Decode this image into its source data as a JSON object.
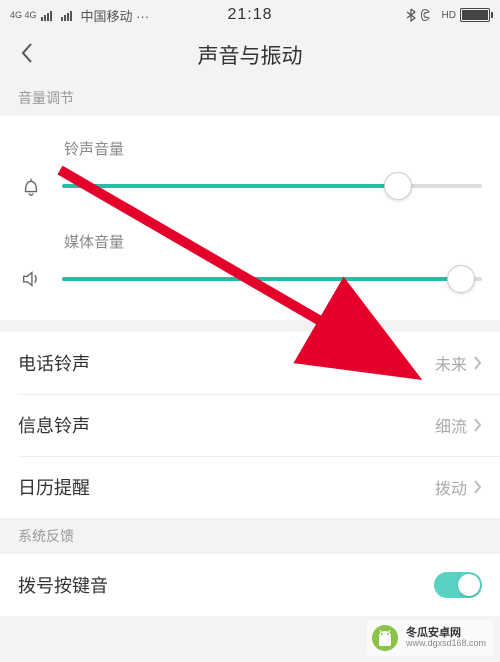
{
  "status": {
    "sig_label": "4G 4G",
    "carrier": "中国移动 ···",
    "time": "21:18",
    "hd_label": "HD"
  },
  "header": {
    "title": "声音与振动"
  },
  "sections": {
    "volume": "音量调节",
    "feedback": "系统反馈"
  },
  "sliders": {
    "ring": {
      "label": "铃声音量",
      "value": 80
    },
    "media": {
      "label": "媒体音量",
      "value": 95
    }
  },
  "rows": {
    "phone_ringtone": {
      "label": "电话铃声",
      "value": "未来"
    },
    "msg_ringtone": {
      "label": "信息铃声",
      "value": "细流"
    },
    "calendar": {
      "label": "日历提醒",
      "value": "拨动"
    },
    "dial_tone": {
      "label": "拨号按键音"
    }
  },
  "watermark": {
    "name": "冬瓜安卓网",
    "url": "www.dgxsd168.com"
  }
}
